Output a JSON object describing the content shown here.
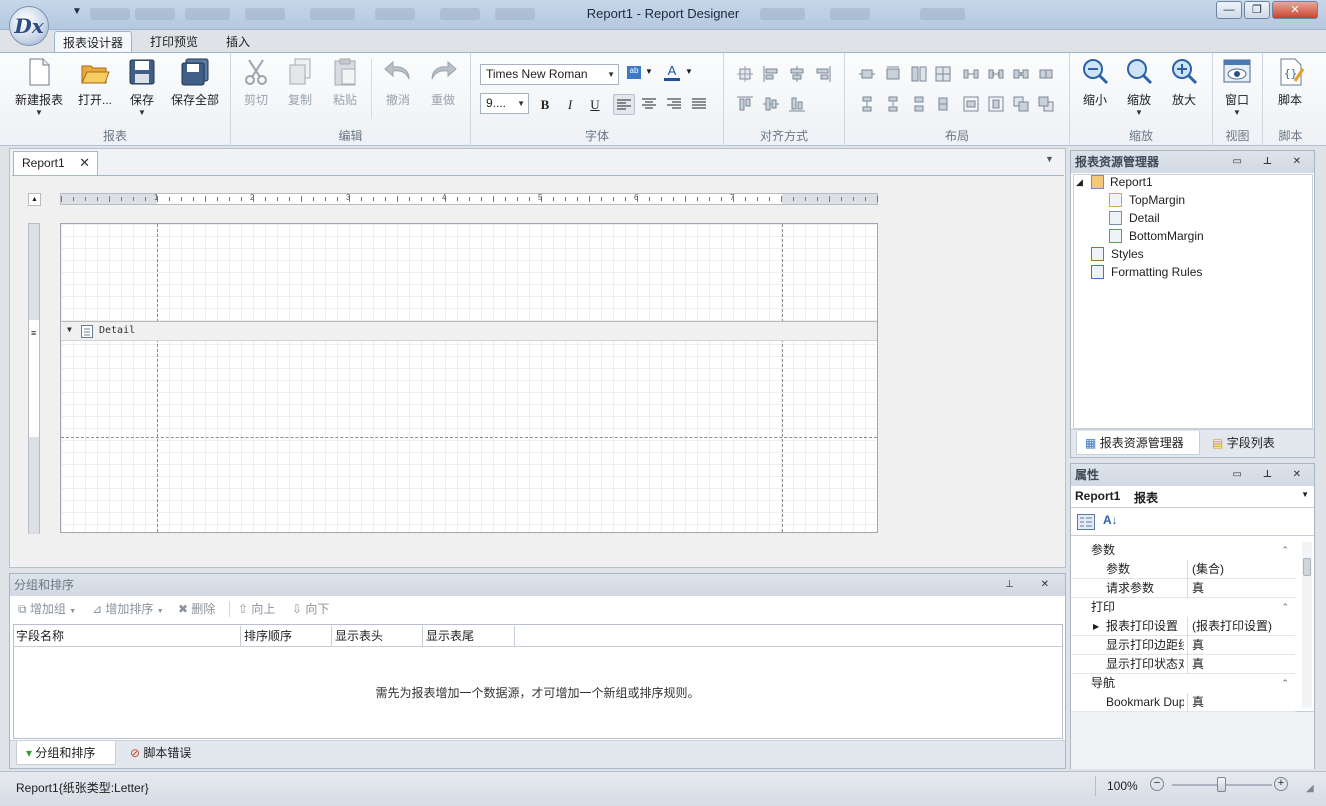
{
  "window": {
    "title": "Report1 - Report Designer",
    "logo_text": "Dx",
    "qat_arrow": "▼",
    "controls": {
      "minimize": "—",
      "maximize": "❐",
      "close": "✕"
    }
  },
  "ribbon": {
    "tabs": [
      "报表设计器",
      "打印预览",
      "插入"
    ],
    "active_tab": "报表设计器",
    "groups": {
      "report": {
        "caption": "报表",
        "buttons": [
          "新建报表",
          "打开...",
          "保存",
          "保存全部"
        ]
      },
      "edit": {
        "caption": "编辑",
        "buttons": [
          "剪切",
          "复制",
          "粘贴",
          "撤消",
          "重做"
        ]
      },
      "font": {
        "caption": "字体",
        "font_name": "Times New Roman",
        "font_size": "9....",
        "bold": "B",
        "italic": "I",
        "underline": "U",
        "fore_color_glyph": "A",
        "back_color_glyph": "ab"
      },
      "align": {
        "caption": "对齐方式"
      },
      "layout": {
        "caption": "布局"
      },
      "zoom": {
        "caption": "缩放",
        "buttons": [
          "缩小",
          "缩放",
          "放大"
        ]
      },
      "view": {
        "caption": "视图",
        "buttons": [
          "窗口"
        ]
      },
      "script": {
        "caption": "脚本",
        "buttons": [
          "脚本"
        ]
      }
    }
  },
  "document": {
    "tab_label": "Report1",
    "tab_close": "✕",
    "band_label": "Detail",
    "band_arrow": "▼",
    "ruler_numbers": [
      "1",
      "2",
      "3",
      "4",
      "5",
      "6",
      "7"
    ]
  },
  "report_explorer": {
    "title": "报表资源管理器",
    "tree": [
      {
        "label": "Report1",
        "level": 0
      },
      {
        "label": "TopMargin",
        "level": 1
      },
      {
        "label": "Detail",
        "level": 1
      },
      {
        "label": "BottomMargin",
        "level": 1
      },
      {
        "label": "Styles",
        "level": 0
      },
      {
        "label": "Formatting Rules",
        "level": 0
      }
    ],
    "tabs": [
      "报表资源管理器",
      "字段列表"
    ]
  },
  "properties": {
    "title": "属性",
    "selected_object": "Report1",
    "selected_type": "报表",
    "categories": [
      {
        "name": "参数",
        "rows": [
          {
            "name": "参数",
            "value": "(集合)"
          },
          {
            "name": "请求参数",
            "value": "真"
          }
        ]
      },
      {
        "name": "打印",
        "rows": [
          {
            "name": "报表打印设置",
            "value": "(报表打印设置)"
          },
          {
            "name": "显示打印边距线",
            "value": "真"
          },
          {
            "name": "显示打印状态对话框",
            "value": "真"
          }
        ]
      },
      {
        "name": "导航",
        "rows": [
          {
            "name": "Bookmark Duplicate Suppress",
            "value": "真"
          }
        ]
      }
    ]
  },
  "group_sort": {
    "title": "分组和排序",
    "toolbar": [
      "增加组",
      "增加排序",
      "删除",
      "向上",
      "向下"
    ],
    "columns": [
      "字段名称",
      "排序顺序",
      "显示表头",
      "显示表尾"
    ],
    "empty_message": "需先为报表增加一个数据源，才可增加一个新组或排序规则。",
    "tabs": [
      "分组和排序",
      "脚本错误"
    ]
  },
  "status": {
    "left": "Report1{纸张类型:Letter}",
    "zoom": "100%",
    "zoom_level": 0.5
  }
}
